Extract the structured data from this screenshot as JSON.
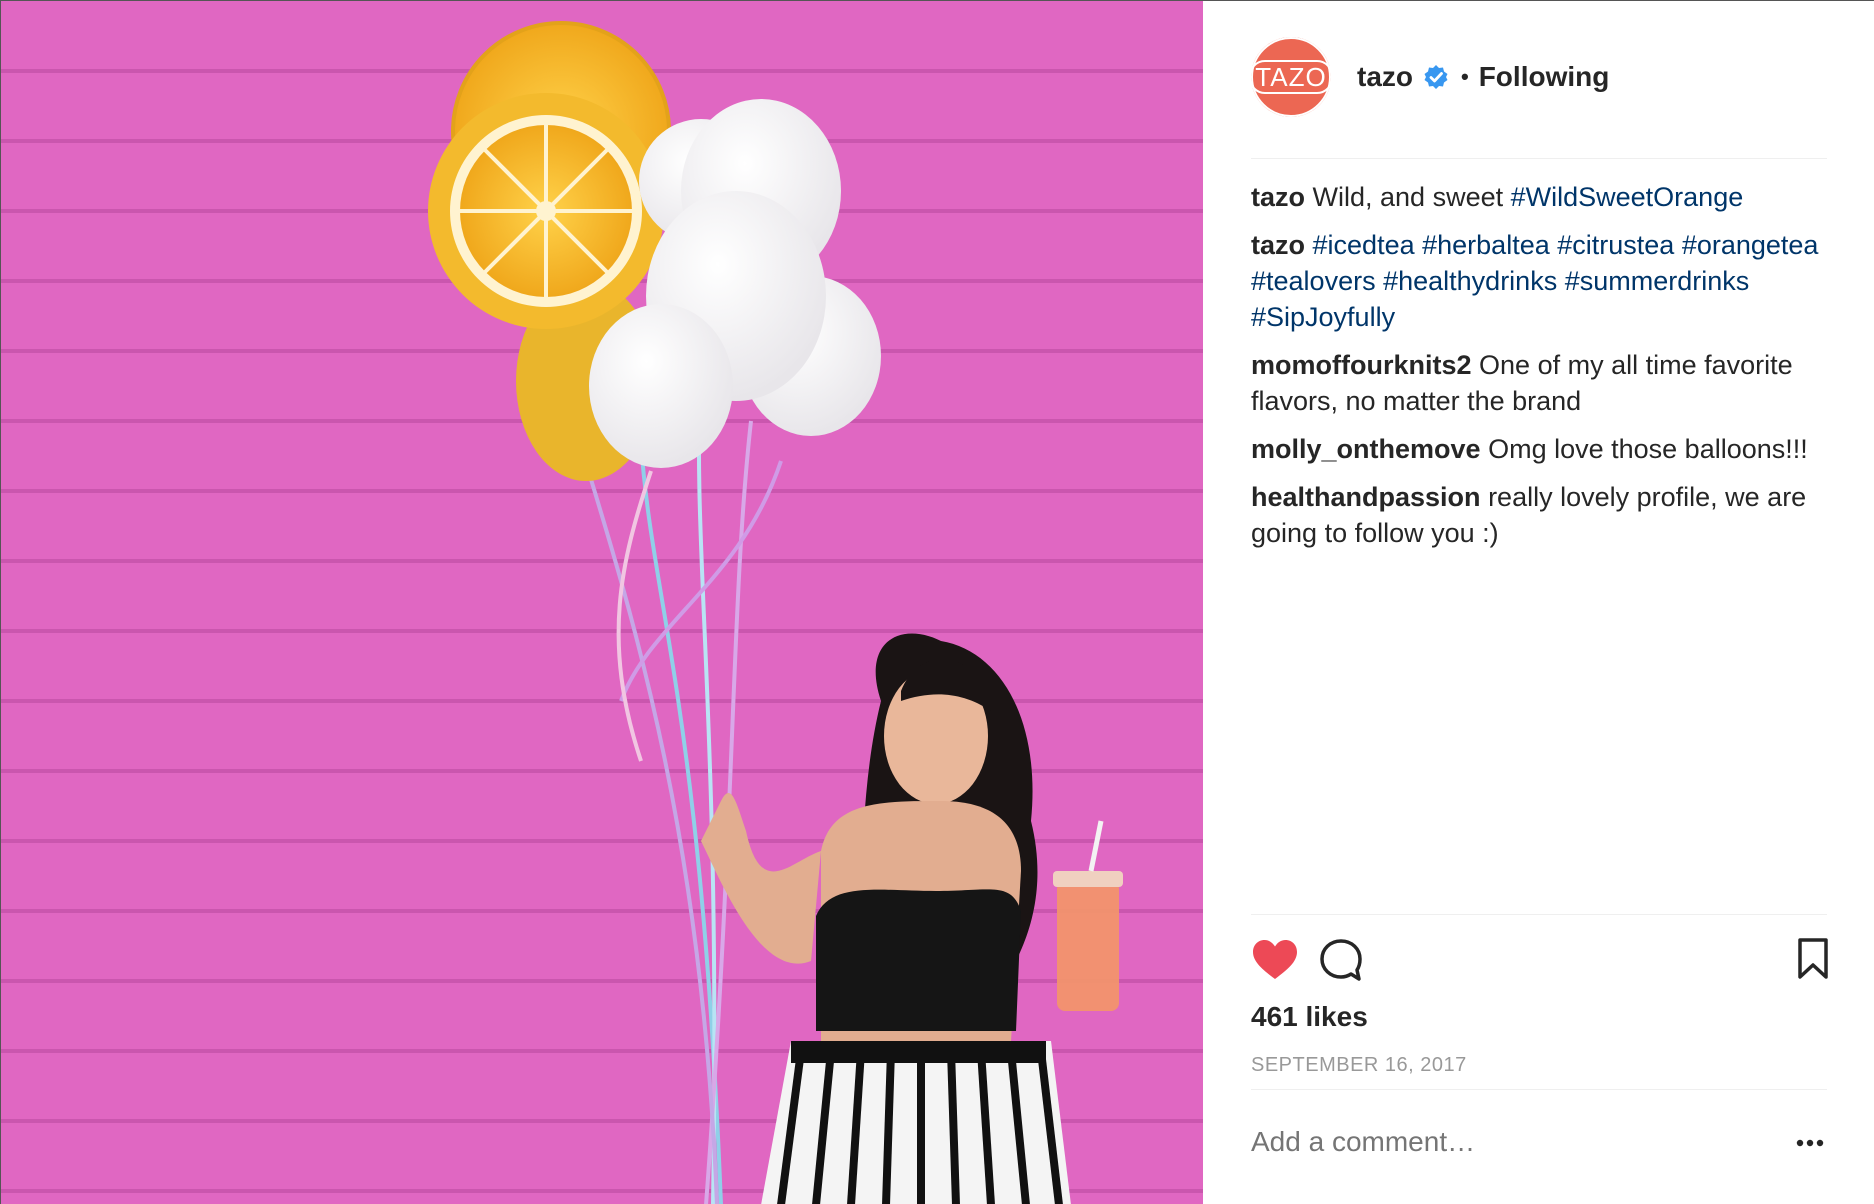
{
  "post": {
    "photo": {
      "description_icon": "photo-icon"
    },
    "header": {
      "avatar_text": "TAZO",
      "username": "tazo",
      "verified_icon": "verified-badge-icon",
      "separator": "•",
      "follow_status": "Following"
    },
    "comments": [
      {
        "user": "tazo",
        "parts": [
          {
            "type": "text",
            "value": "Wild, and sweet "
          },
          {
            "type": "hashtag",
            "value": "#WildSweetOrange"
          }
        ]
      },
      {
        "user": "tazo",
        "parts": [
          {
            "type": "hashtag",
            "value": "#icedtea"
          },
          {
            "type": "text",
            "value": " "
          },
          {
            "type": "hashtag",
            "value": "#herbaltea"
          },
          {
            "type": "text",
            "value": " "
          },
          {
            "type": "hashtag",
            "value": "#citrustea"
          },
          {
            "type": "text",
            "value": " "
          },
          {
            "type": "hashtag",
            "value": "#orangetea"
          },
          {
            "type": "text",
            "value": " "
          },
          {
            "type": "hashtag",
            "value": "#tealovers"
          },
          {
            "type": "text",
            "value": " "
          },
          {
            "type": "hashtag",
            "value": "#healthydrinks"
          },
          {
            "type": "text",
            "value": " "
          },
          {
            "type": "hashtag",
            "value": "#summerdrinks"
          },
          {
            "type": "text",
            "value": " "
          },
          {
            "type": "hashtag",
            "value": "#SipJoyfully"
          }
        ]
      },
      {
        "user": "momoffourknits2",
        "parts": [
          {
            "type": "text",
            "value": "One of my all time favorite flavors, no matter the brand"
          }
        ]
      },
      {
        "user": "molly_onthemove",
        "parts": [
          {
            "type": "text",
            "value": "Omg love those balloons!!!"
          }
        ]
      },
      {
        "user": "healthandpassion",
        "parts": [
          {
            "type": "text",
            "value": "really lovely profile, we are going to follow you :)"
          }
        ]
      }
    ],
    "actions": {
      "like_icon": "heart-filled-icon",
      "comment_icon": "comment-bubble-icon",
      "save_icon": "bookmark-icon"
    },
    "likes": "461 likes",
    "date": "SEPTEMBER 16, 2017",
    "add_comment": {
      "placeholder": "Add a comment…"
    },
    "more_icon": "more-options-icon",
    "colors": {
      "like": "#ed4956",
      "hashtag": "#003569",
      "avatar": "#ec6753",
      "verified": "#3897f0",
      "photo_background": "#e067c2"
    }
  }
}
